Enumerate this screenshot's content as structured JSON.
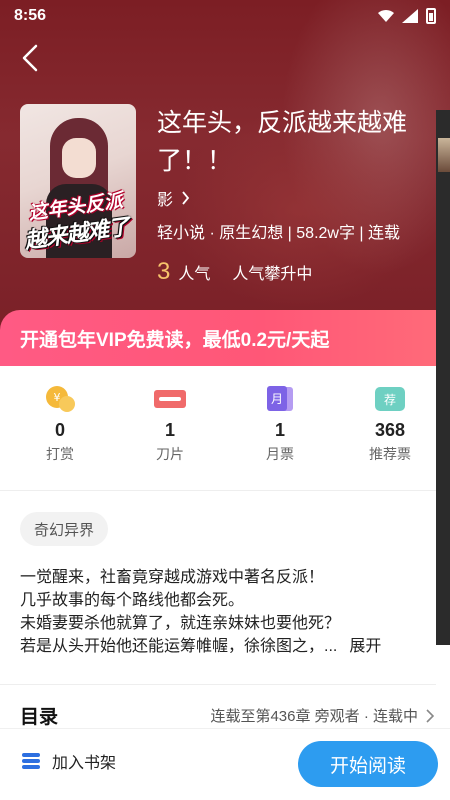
{
  "status_bar": {
    "time": "8:56"
  },
  "book": {
    "cover_title_line1": "这年头反派",
    "cover_title_line2": "越来越难了",
    "title": "这年头，反派越来越难了！！",
    "author": "影",
    "meta": "轻小说 · 原生幻想 | 58.2w字 | 连载",
    "popularity_num": "3",
    "popularity_label": "人气",
    "popularity_trend": "人气攀升中"
  },
  "vip_banner": "开通包年VIP免费读，最低0.2元/天起",
  "stats": [
    {
      "value": "0",
      "label": "打赏",
      "icon": "coin-icon"
    },
    {
      "value": "1",
      "label": "刀片",
      "icon": "blade-icon"
    },
    {
      "value": "1",
      "label": "月票",
      "icon": "monthly-ticket-icon"
    },
    {
      "value": "368",
      "label": "推荐票",
      "icon": "recommend-ticket-icon"
    }
  ],
  "stat_icon_text": {
    "monthly": "月",
    "recommend": "荐"
  },
  "tag": "奇幻异界",
  "synopsis": [
    "一觉醒来，社畜竟穿越成游戏中著名反派！",
    "几乎故事的每个路线他都会死。",
    "未婚妻要杀他就算了，就连亲妹妹也要他死？",
    "若是从头开始他还能运筹帷幄，徐徐图之，..."
  ],
  "synopsis_expand": "展开",
  "toc": {
    "title": "目录",
    "status": "连载至第436章 旁观者 · 连载中"
  },
  "bottom": {
    "shelf_label": "加入书架",
    "read_label": "开始阅读"
  },
  "colors": {
    "hero_bg": "#7c1e24",
    "vip_gradient_start": "#ff5a84",
    "read_button": "#2d9cf0",
    "popularity_num": "#f7c36b"
  }
}
